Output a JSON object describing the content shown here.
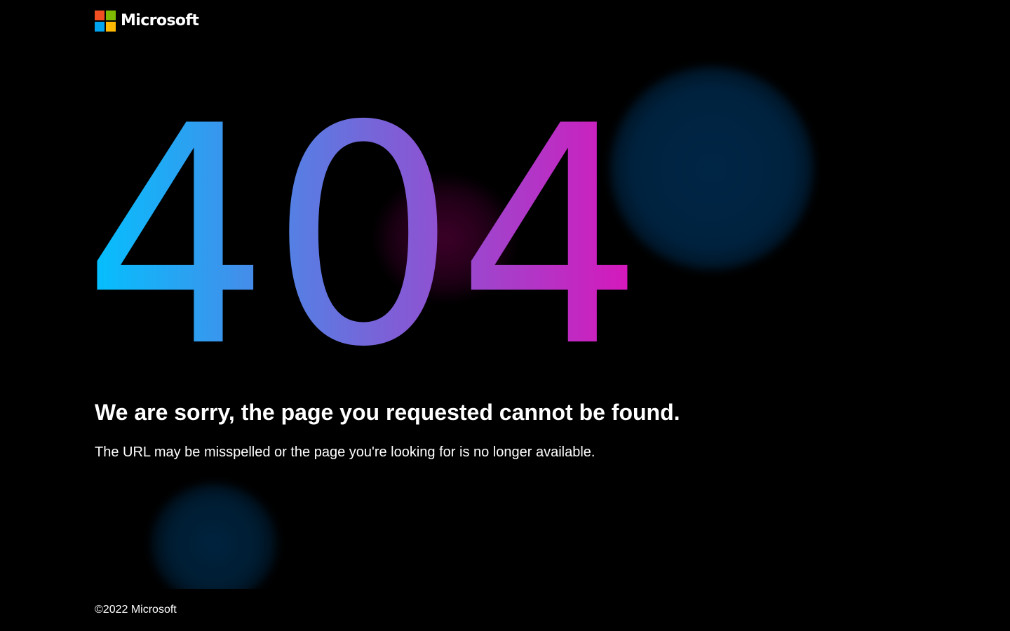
{
  "header": {
    "logo_text": "Microsoft",
    "logo_colors": {
      "red": "#f25022",
      "green": "#7fba00",
      "blue": "#00a4ef",
      "yellow": "#ffb900"
    }
  },
  "error": {
    "code_digits": [
      "4",
      "0",
      "4"
    ],
    "gradient": {
      "start": "#00c3ff",
      "middle": "#7a62d8",
      "end": "#e010b8"
    },
    "title": "We are sorry, the page you requested cannot be found.",
    "message": "The URL may be misspelled or the page you're looking for is no longer available."
  },
  "footer": {
    "copyright": "©2022 Microsoft"
  }
}
